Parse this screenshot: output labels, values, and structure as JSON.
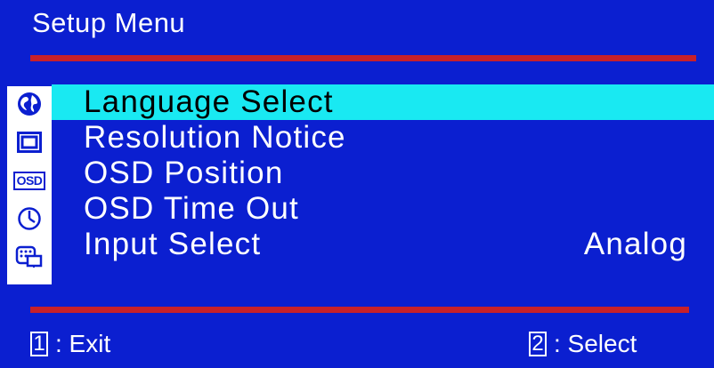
{
  "title": "Setup Menu",
  "colors": {
    "background": "#0b1fd0",
    "rule": "#c8202a",
    "highlight": "#19e9f2",
    "text": "#ffffff"
  },
  "menu": {
    "items": [
      {
        "label": "Language Select",
        "icon": "globe-icon",
        "selected": true,
        "value": ""
      },
      {
        "label": "Resolution Notice",
        "icon": "monitor-icon",
        "selected": false,
        "value": ""
      },
      {
        "label": "OSD Position",
        "icon": "osd-icon",
        "selected": false,
        "value": ""
      },
      {
        "label": "OSD Time Out",
        "icon": "clock-icon",
        "selected": false,
        "value": ""
      },
      {
        "label": "Input Select",
        "icon": "input-select-icon",
        "selected": false,
        "value": "Analog"
      }
    ],
    "osd_icon_text": "OSD"
  },
  "footer": {
    "left_key": "1",
    "left_label": ": Exit",
    "right_key": "2",
    "right_label": ": Select"
  }
}
